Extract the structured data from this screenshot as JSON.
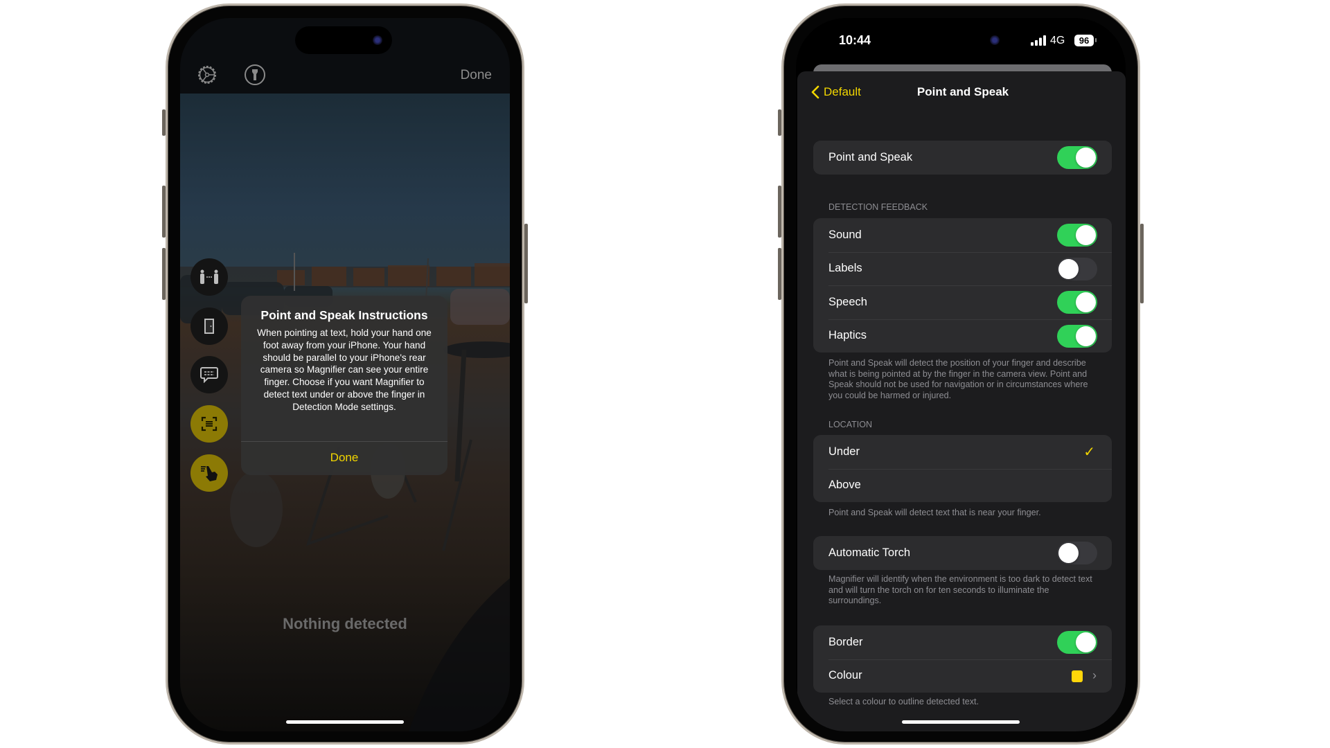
{
  "colors": {
    "accent_yellow": "#f2d600",
    "toggle_on": "#30d158",
    "toggle_off": "#39393d",
    "border_colour_swatch": "#ffd60a"
  },
  "left_phone": {
    "toolbar": {
      "settings_icon": "gear-icon",
      "torch_icon": "flashlight-icon",
      "done_label": "Done"
    },
    "mode_buttons": [
      {
        "icon": "people-detection-icon",
        "active": false
      },
      {
        "icon": "door-detection-icon",
        "active": false
      },
      {
        "icon": "image-description-icon",
        "active": false
      },
      {
        "icon": "text-detection-icon",
        "active": true
      },
      {
        "icon": "point-and-speak-icon",
        "active": true
      }
    ],
    "dialog": {
      "title": "Point and Speak Instructions",
      "body": "When pointing at text, hold your hand one foot away from your iPhone. Your hand should be parallel to your iPhone's rear camera so Magnifier can see your entire finger. Choose if you want Magnifier to detect text under or above the finger in Detection Mode settings.",
      "button": "Done"
    },
    "status_text": "Nothing detected"
  },
  "right_phone": {
    "status_bar": {
      "time": "10:44",
      "network": "4G",
      "battery": "96"
    },
    "nav": {
      "back_label": "Default",
      "title": "Point and Speak"
    },
    "main_toggle": {
      "label": "Point and Speak",
      "on": true
    },
    "detection_feedback": {
      "header": "DETECTION FEEDBACK",
      "items": [
        {
          "label": "Sound",
          "on": true
        },
        {
          "label": "Labels",
          "on": false
        },
        {
          "label": "Speech",
          "on": true
        },
        {
          "label": "Haptics",
          "on": true
        }
      ],
      "footer": "Point and Speak will detect the position of your finger and describe what is being pointed at by the finger in the camera view. Point and Speak should not be used for navigation or in circumstances where you could be harmed or injured."
    },
    "location": {
      "header": "LOCATION",
      "options": [
        {
          "label": "Under",
          "selected": true
        },
        {
          "label": "Above",
          "selected": false
        }
      ],
      "footer": "Point and Speak will detect text that is near your finger."
    },
    "automatic_torch": {
      "label": "Automatic Torch",
      "on": false,
      "footer": "Magnifier will identify when the environment is too dark to detect text and will turn the torch on for ten seconds to illuminate the surroundings."
    },
    "border": {
      "label": "Border",
      "on": true
    },
    "colour": {
      "label": "Colour",
      "footer": "Select a colour to outline detected text."
    }
  }
}
